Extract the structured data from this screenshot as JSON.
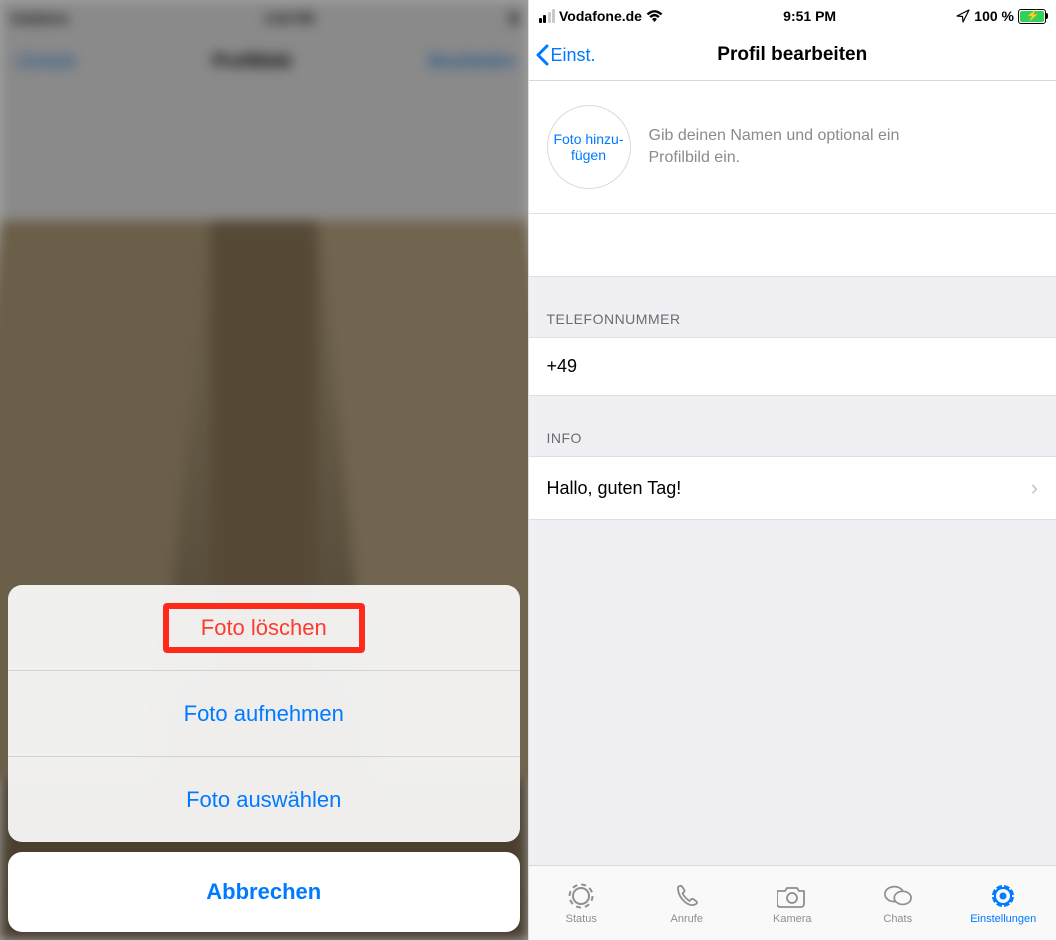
{
  "left": {
    "statusbar": {
      "carrier": "Vodafone",
      "time": "3:00 PM"
    },
    "nav": {
      "back": "Zurück",
      "title": "Profilbild",
      "edit": "Bearbeiten"
    },
    "sheet": {
      "delete": "Foto löschen",
      "take": "Foto aufnehmen",
      "choose": "Foto auswählen",
      "cancel": "Abbrechen"
    }
  },
  "right": {
    "statusbar": {
      "carrier": "Vodafone.de",
      "time": "9:51 PM",
      "battery": "100 %"
    },
    "nav": {
      "back": "Einst.",
      "title": "Profil bearbeiten"
    },
    "addPhoto": "Foto hinzu­fügen",
    "hint": "Gib deinen Namen und optional ein Profilbild ein.",
    "phoneSection": "TELEFONNUMMER",
    "phoneValue": "+49",
    "infoSection": "INFO",
    "infoValue": "Hallo, guten Tag!",
    "tabs": {
      "status": "Status",
      "calls": "Anrufe",
      "camera": "Kamera",
      "chats": "Chats",
      "settings": "Einstellungen"
    }
  }
}
